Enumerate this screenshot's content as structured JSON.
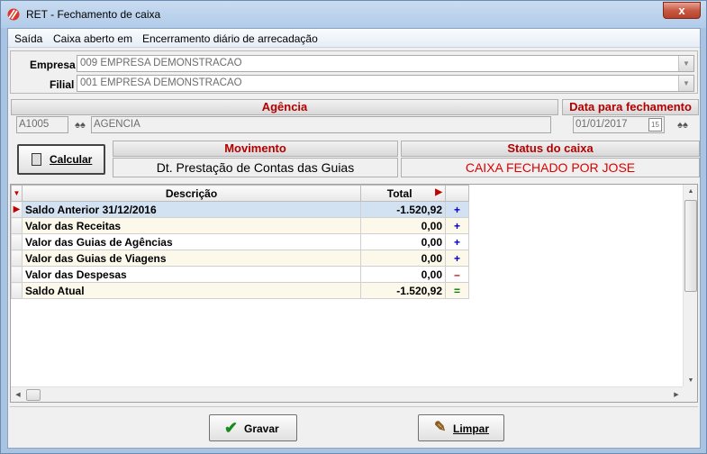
{
  "window": {
    "title": "RET - Fechamento de caixa",
    "close_label": "x"
  },
  "menu": [
    {
      "label": "Saída"
    },
    {
      "label": "Caixa aberto em"
    },
    {
      "label": "Encerramento diário de arrecadação"
    }
  ],
  "empresa": {
    "label": "Empresa",
    "value": "009 EMPRESA DEMONSTRACAO"
  },
  "filial": {
    "label": "Filial",
    "value": "001 EMPRESA DEMONSTRACAO"
  },
  "agencia": {
    "header": "Agência",
    "code": "A1005",
    "name": "AGENCIA"
  },
  "data_fechamento": {
    "header": "Data para fechamento",
    "value": "01/01/2017",
    "calendar_label": "15"
  },
  "calcular": {
    "label": "Calcular"
  },
  "movimento": {
    "header": "Movimento",
    "value": "Dt. Prestação de Contas das Guias"
  },
  "status": {
    "header": "Status do caixa",
    "value": "CAIXA FECHADO POR JOSE",
    "color": "#e00000"
  },
  "grid": {
    "columns": {
      "descricao": "Descrição",
      "total": "Total"
    },
    "rows": [
      {
        "descricao": "Saldo Anterior  31/12/2016",
        "total": "-1.520,92",
        "sign": "+"
      },
      {
        "descricao": "Valor das Receitas",
        "total": "0,00",
        "sign": "+"
      },
      {
        "descricao": "Valor das Guias de Agências",
        "total": "0,00",
        "sign": "+"
      },
      {
        "descricao": "Valor das Guias de Viagens",
        "total": "0,00",
        "sign": "+"
      },
      {
        "descricao": "Valor das Despesas",
        "total": "0,00",
        "sign": "–"
      },
      {
        "descricao": "Saldo Atual",
        "total": "-1.520,92",
        "sign": "="
      }
    ]
  },
  "buttons": {
    "gravar": "Gravar",
    "limpar": "Limpar"
  }
}
